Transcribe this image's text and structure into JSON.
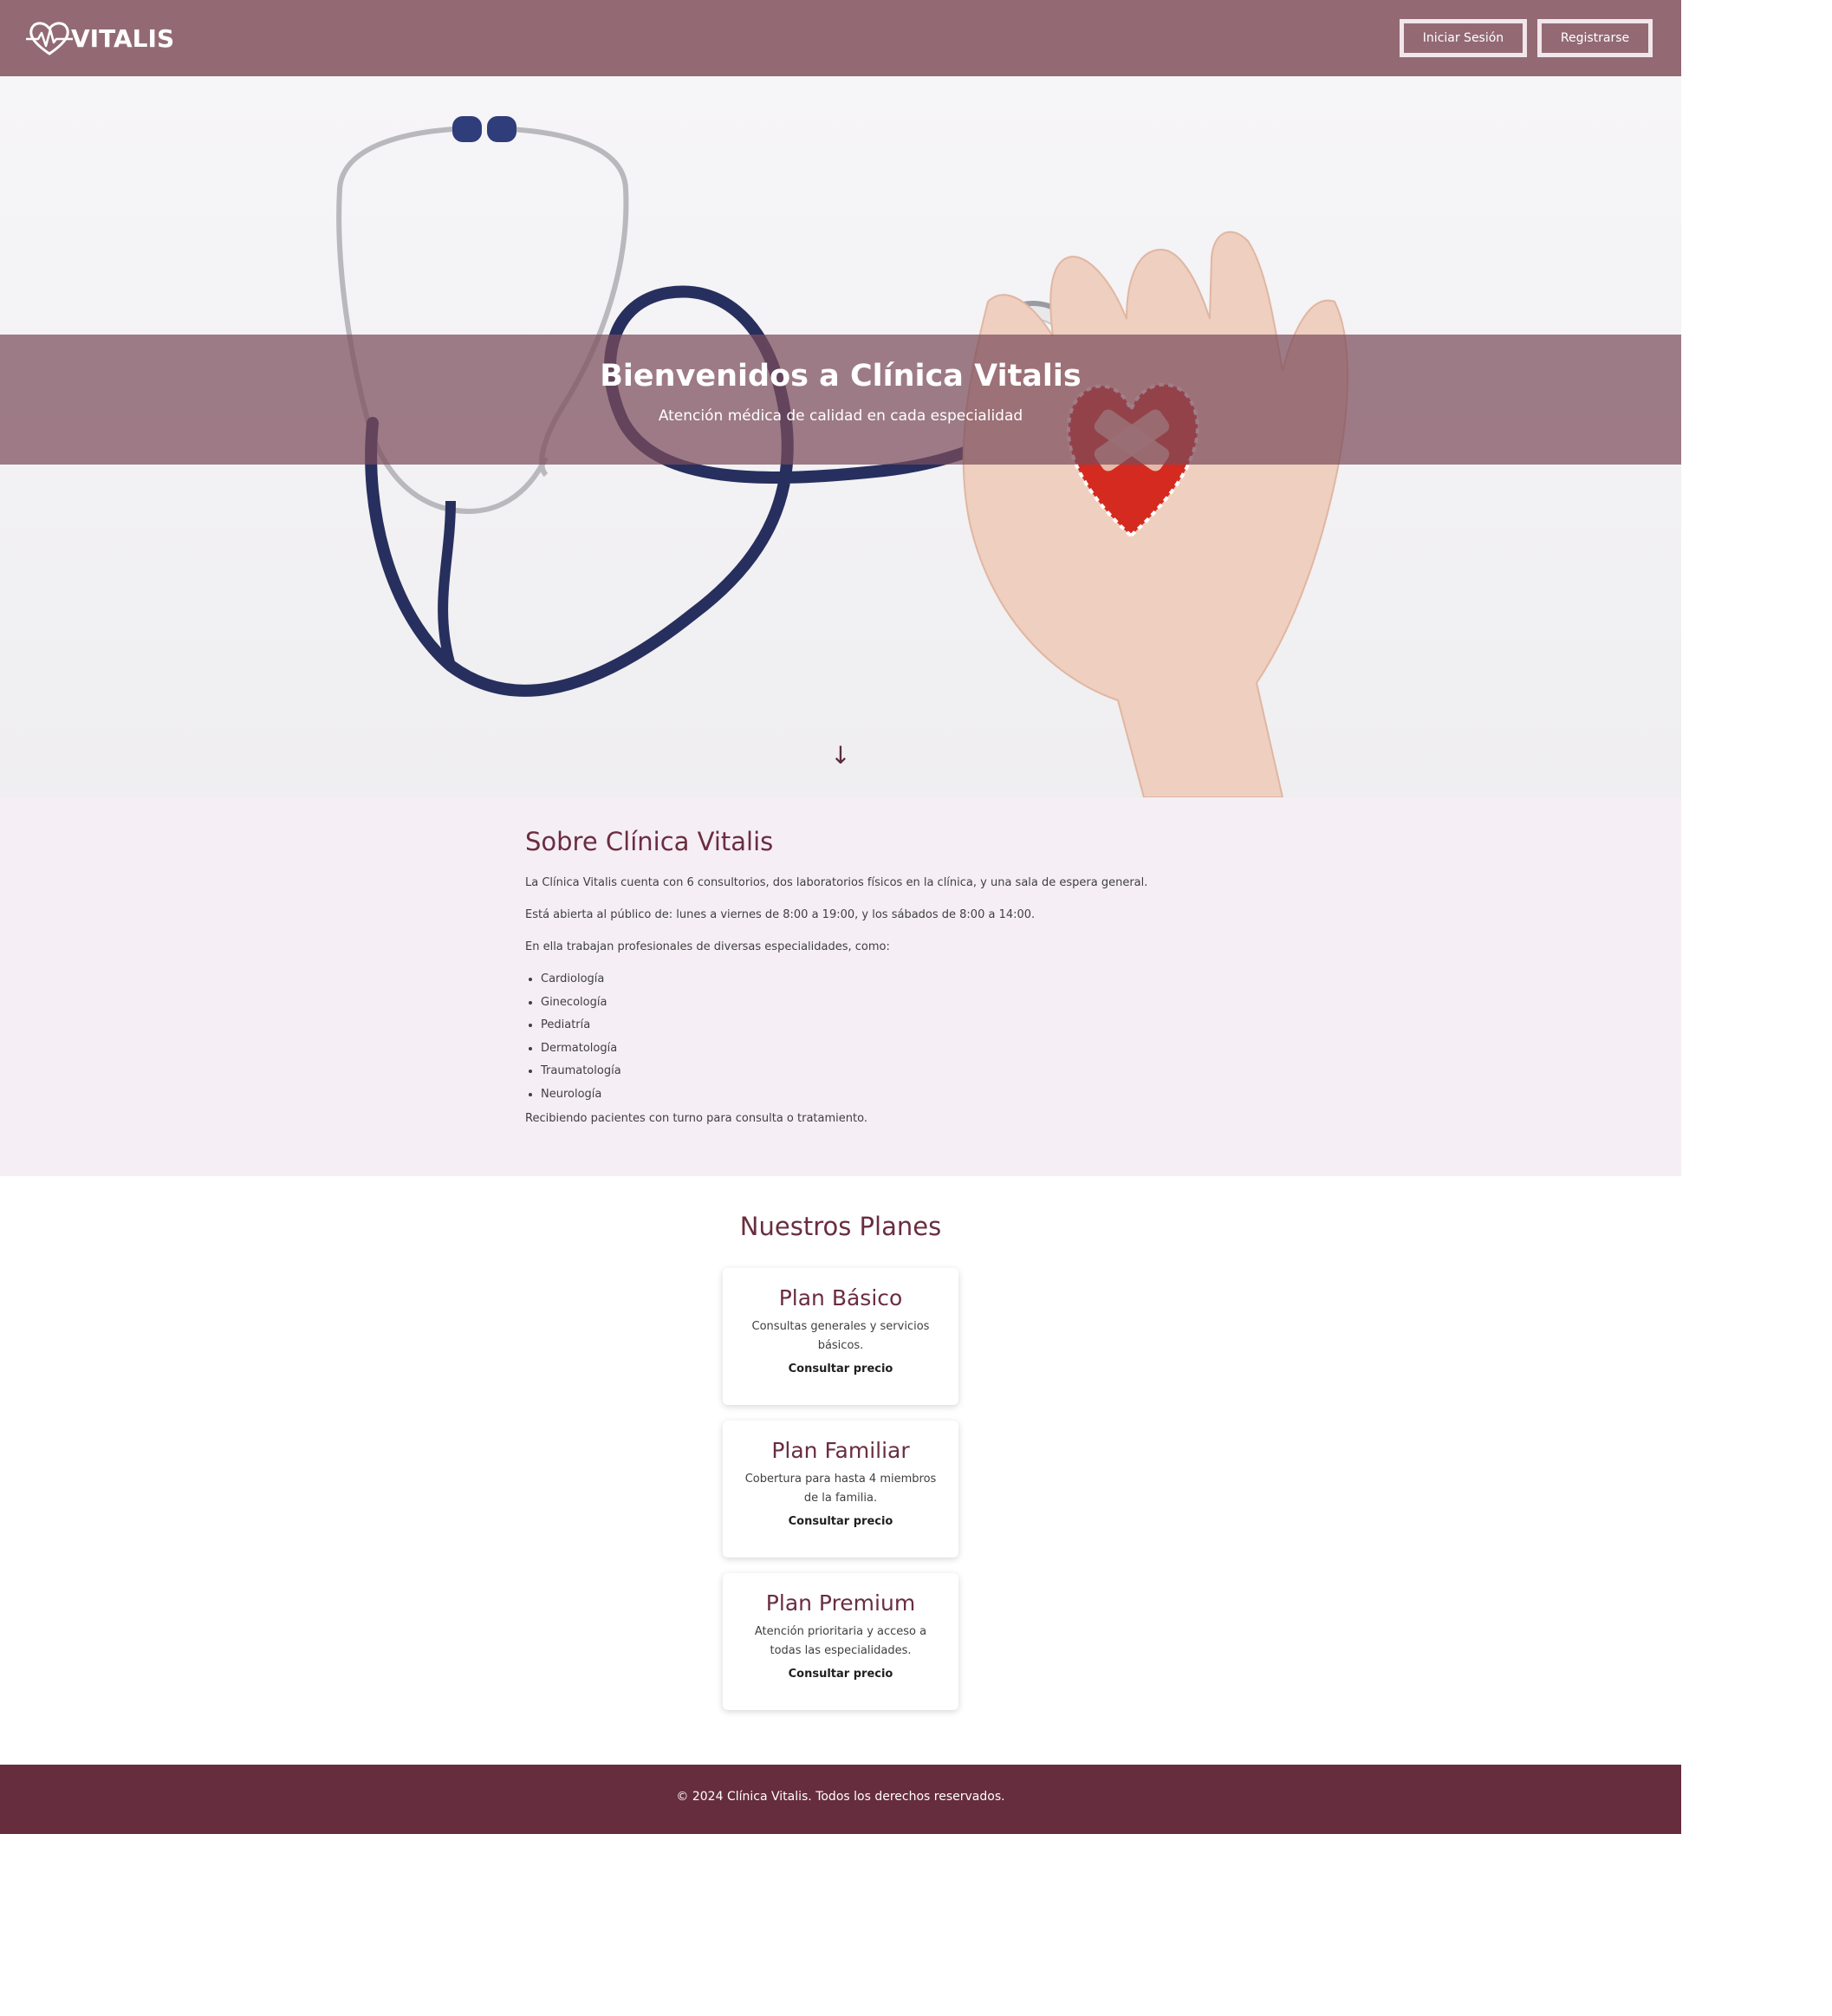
{
  "header": {
    "logo_text": "VITALIS",
    "login_label": "Iniciar Sesión",
    "register_label": "Registrarse"
  },
  "hero": {
    "title": "Bienvenidos a Clínica Vitalis",
    "subtitle": "Atención médica de calidad en cada especialidad",
    "scroll_arrow": "↓"
  },
  "about": {
    "title": "Sobre Clínica Vitalis",
    "paragraphs": [
      "La Clínica Vitalis cuenta con 6 consultorios, dos laboratorios físicos en la clínica, y una sala de espera general.",
      "Está abierta al público de: lunes a viernes de 8:00 a 19:00, y los sábados de 8:00 a 14:00.",
      "En ella trabajan profesionales de diversas especialidades, como:"
    ],
    "specialties": [
      "Cardiología",
      "Ginecología",
      "Pediatría",
      "Dermatología",
      "Traumatología",
      "Neurología"
    ],
    "closing": "Recibiendo pacientes con turno para consulta o tratamiento."
  },
  "plans": {
    "title": "Nuestros Planes",
    "items": [
      {
        "name": "Plan Básico",
        "description": "Consultas generales y servicios básicos.",
        "price_label": "Consultar precio"
      },
      {
        "name": "Plan Familiar",
        "description": "Cobertura para hasta 4 miembros de la familia.",
        "price_label": "Consultar precio"
      },
      {
        "name": "Plan Premium",
        "description": "Atención prioritaria y acceso a todas las especialidades.",
        "price_label": "Consultar precio"
      }
    ]
  },
  "footer": {
    "text": "© 2024 Clínica Vitalis. Todos los derechos reservados."
  },
  "colors": {
    "header_bg": "#936a74",
    "brand_dark": "#662d3f",
    "about_bg": "#f6eef5",
    "hero_band": "#7b4c5c"
  },
  "icons": {
    "logo": "heart-pulse-icon",
    "scroll": "arrow-down-icon"
  }
}
